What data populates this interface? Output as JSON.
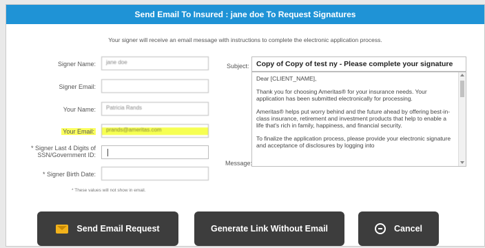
{
  "dialog": {
    "title": "Send Email To Insured : jane doe To Request Signatures",
    "intro": "Your signer will receive an email message with instructions to complete the electronic application process.",
    "note": "* These values will not show in email."
  },
  "form": {
    "signer_name": {
      "label": "Signer Name:",
      "value": "jane doe"
    },
    "signer_email": {
      "label": "Signer Email:",
      "value": ""
    },
    "your_name": {
      "label": "Your Name:",
      "value": "Patricia Rands"
    },
    "your_email": {
      "label": "Your Email:",
      "value": "prands@ameritas.com"
    },
    "ssn": {
      "label_line1": "* Signer Last 4 Digits of",
      "label_line2": "SSN/Government ID:",
      "value": ""
    },
    "birth_date": {
      "label": "* Signer Birth Date:",
      "value": ""
    }
  },
  "email": {
    "subject_label": "Subject:",
    "subject_value": "Copy of Copy of test ny - Please complete your signature",
    "message_label": "Message:",
    "message_paragraphs": [
      "Dear [CLIENT_NAME],",
      "Thank you for choosing Ameritas® for your insurance needs. Your application has been submitted electronically for processing.",
      "Ameritas® helps put worry behind and the future ahead by offering best-in-class insurance, retirement and investment products that help to enable a life that's rich in family, happiness, and financial security.",
      "To finalize the application process, please provide your electronic signature and acceptance of disclosures by logging into"
    ]
  },
  "buttons": {
    "send": "Send Email Request",
    "generate": "Generate Link Without Email",
    "cancel": "Cancel"
  },
  "colors": {
    "titlebar": "#1f93d6",
    "button": "#3d3d3d",
    "highlight": "#fbff5e",
    "envelope": "#f2b21b"
  },
  "icons": {
    "send": "envelope-icon",
    "cancel": "minus-circle-icon"
  }
}
